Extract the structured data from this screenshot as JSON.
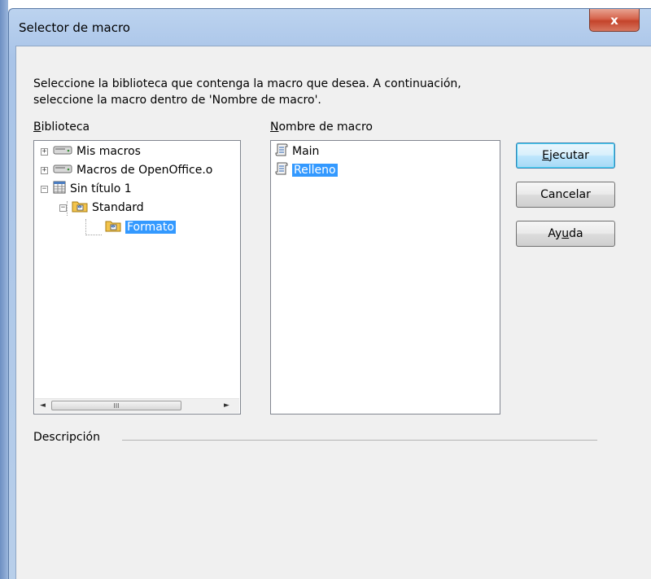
{
  "window": {
    "title": "Selector de macro",
    "close_glyph": "x"
  },
  "instructions": "Seleccione la biblioteca que contenga la macro que desea. A continuación, seleccione la macro dentro de 'Nombre de macro'.",
  "library": {
    "label_accel": "B",
    "label_rest": "iblioteca",
    "items": [
      {
        "label": "Mis macros",
        "icon": "drive-icon",
        "expander": "+"
      },
      {
        "label": "Macros de OpenOffice.o",
        "icon": "drive-icon",
        "expander": "+"
      },
      {
        "label": "Sin título 1",
        "icon": "spreadsheet-doc-icon",
        "expander": "−"
      },
      {
        "label": "Standard",
        "icon": "basic-library-folder-icon",
        "expander": "−"
      },
      {
        "label": "Formato",
        "icon": "basic-module-folder-icon",
        "selected": true
      }
    ],
    "scroll": {
      "left": "◄",
      "right": "►",
      "thumb_grip": "III"
    }
  },
  "macro_names": {
    "label_accel": "N",
    "label_rest": "ombre de macro",
    "items": [
      {
        "label": "Main",
        "icon": "macro-scroll-icon"
      },
      {
        "label": "Relleno",
        "icon": "macro-scroll-icon",
        "selected": true
      }
    ]
  },
  "buttons": {
    "run_pre": "",
    "run_accel": "E",
    "run_post": "jecutar",
    "cancel": "Cancelar",
    "help_pre": "Ay",
    "help_accel": "u",
    "help_post": "da"
  },
  "description_label": "Descripción",
  "colors": {
    "selection": "#3399ff",
    "title_bar": "#b8cfea",
    "close_button": "#c4432a"
  }
}
